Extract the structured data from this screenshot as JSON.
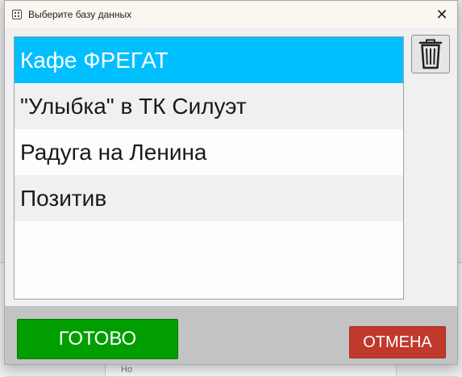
{
  "window": {
    "title": "Выберите базу данных",
    "close_glyph": "✕"
  },
  "databases": {
    "items": [
      {
        "label": "Кафе ФРЕГАТ",
        "selected": true
      },
      {
        "label": "\"Улыбка\" в ТК Силуэт",
        "selected": false
      },
      {
        "label": "Радуга на Ленина",
        "selected": false
      },
      {
        "label": "Позитив",
        "selected": false
      }
    ]
  },
  "toolbar": {
    "delete_icon": "trash-icon"
  },
  "footer": {
    "ok_label": "ГОТОВО",
    "cancel_label": "ОТМЕНА"
  },
  "background": {
    "partial_text": "Но"
  },
  "colors": {
    "selection": "#00bfff",
    "ok": "#009e00",
    "cancel": "#c0392b"
  }
}
